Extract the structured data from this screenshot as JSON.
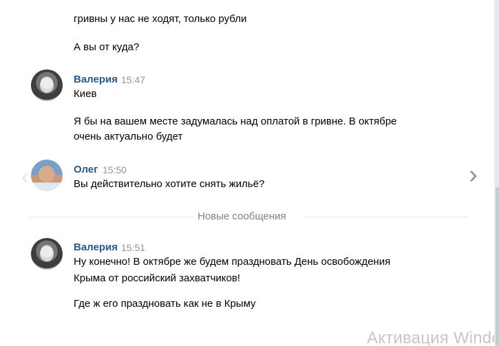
{
  "messages": {
    "earlier_1": "гривны у нас не ходят, только рубли",
    "earlier_2": "А вы от куда?",
    "group_1": {
      "sender": "Валерия",
      "time": "15:47",
      "lines": [
        "Киев",
        "Я бы на вашем месте задумалась над оплатой в гривне. В октябре",
        "очень актуально будет"
      ]
    },
    "group_2": {
      "sender": "Олег",
      "time": "15:50",
      "lines": [
        "Вы действительно хотите снять жильё?"
      ]
    },
    "new_messages_label": "Новые сообщения",
    "group_3": {
      "sender": "Валерия",
      "time": "15:51",
      "lines": [
        "Ну конечно! В октябре же будем праздновать День освобождения",
        "Крыма от российский захватчиков!",
        "Где ж его праздновать как не в Крыму"
      ]
    }
  },
  "icons": {
    "next": "chevron-right-icon",
    "previous": "chevron-left-icon"
  },
  "watermark": "Активация Windo"
}
